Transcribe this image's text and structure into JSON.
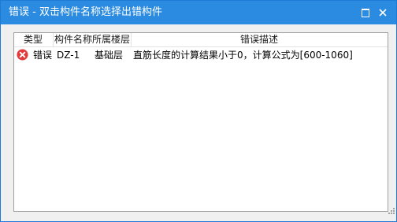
{
  "window": {
    "title": "错误 - 双击构件名称选择出错构件"
  },
  "columns": {
    "type": "类型",
    "component_name": "构件名称",
    "floor": "所属楼层",
    "description": "错误描述"
  },
  "rows": [
    {
      "icon": "error-circle-icon",
      "type": "错误",
      "component_name": "DZ-1",
      "floor": "基础层",
      "description": "直筋长度的计算结果小于0，计算公式为[600-1060]"
    }
  ],
  "colors": {
    "titlebar": "#2b8be0",
    "error_icon": "#e23a3a"
  }
}
